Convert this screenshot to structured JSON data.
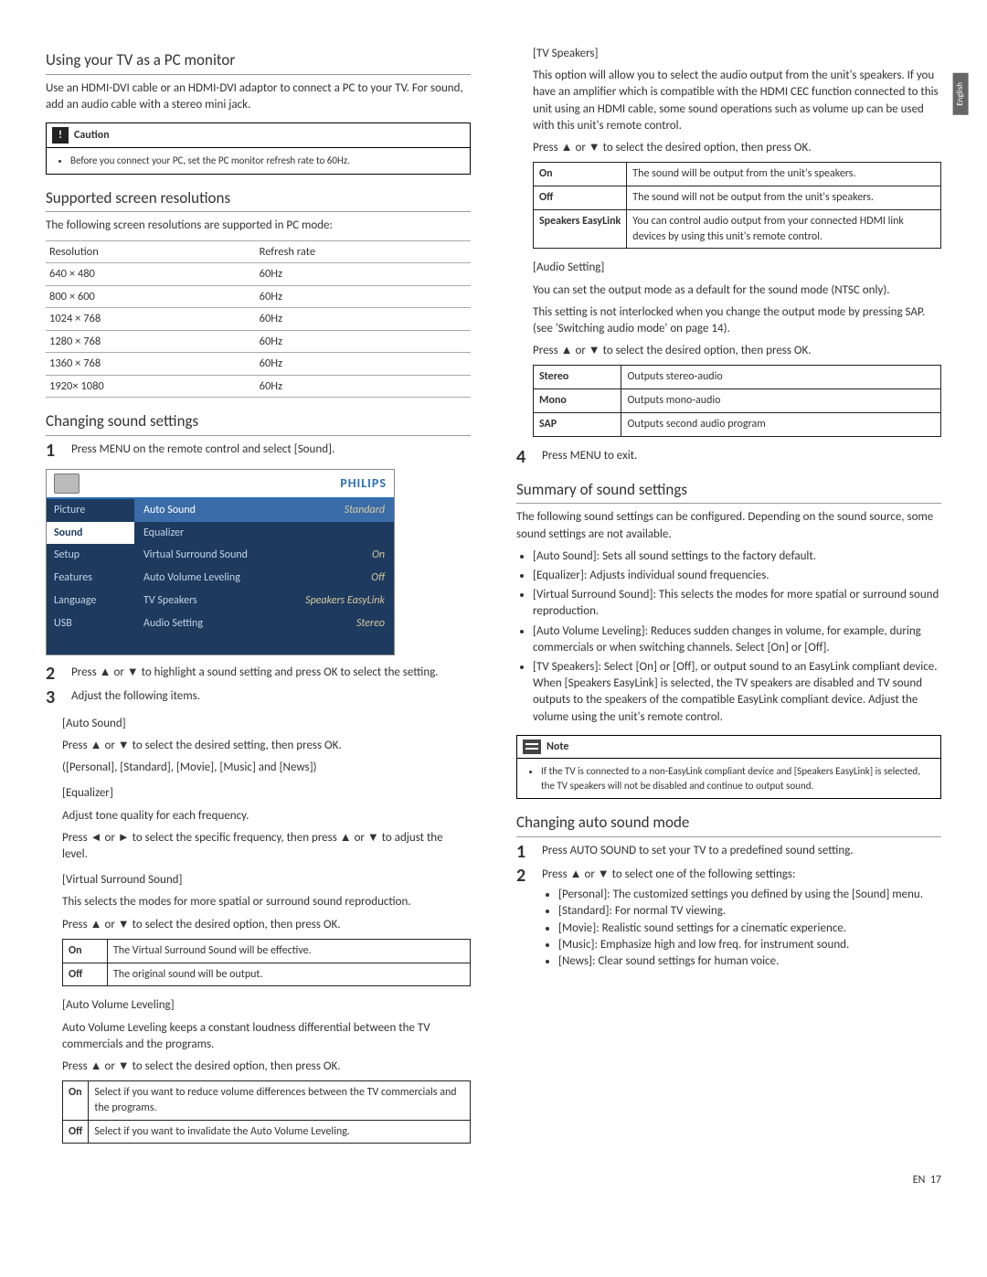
{
  "langTab": "English",
  "footer": {
    "lang": "EN",
    "page": "17"
  },
  "left": {
    "h_pc": "Using your TV as a PC monitor",
    "pc_intro": "Use an HDMI-DVI cable or an HDMI-DVI adaptor to connect a PC to your TV. For sound, add an audio cable with a stereo mini jack.",
    "caution_label": "Caution",
    "caution_item": "Before you connect your PC, set the PC monitor refresh rate to 60Hz.",
    "h_res": "Supported screen resolutions",
    "res_intro": "The following screen resolutions are supported in PC mode:",
    "res_h1": "Resolution",
    "res_h2": "Refresh rate",
    "res_rows": [
      [
        "640 × 480",
        "60Hz"
      ],
      [
        "800 × 600",
        "60Hz"
      ],
      [
        "1024 × 768",
        "60Hz"
      ],
      [
        "1280 × 768",
        "60Hz"
      ],
      [
        "1360 × 768",
        "60Hz"
      ],
      [
        "1920× 1080",
        "60Hz"
      ]
    ],
    "h_sound": "Changing sound settings",
    "step1": "Press MENU on the remote control and select [Sound].",
    "step2": "Press ▲ or ▼ to highlight a sound setting and press OK to select the setting.",
    "step3": "Adjust the following items.",
    "tv_logo": "PHILIPS",
    "tv_cats": [
      "Picture",
      "Sound",
      "Setup",
      "Features",
      "Language",
      "USB"
    ],
    "tv_rows": [
      [
        "Auto Sound",
        "Standard"
      ],
      [
        "Equalizer",
        ""
      ],
      [
        "Virtual Surround Sound",
        "On"
      ],
      [
        "Auto Volume Leveling",
        "Off"
      ],
      [
        "TV Speakers",
        "Speakers EasyLink"
      ],
      [
        "Audio Setting",
        "Stereo"
      ]
    ],
    "auto_sound_h": "[Auto Sound]",
    "auto_sound_p1": "Press ▲ or ▼ to select the desired setting, then press OK.",
    "auto_sound_p2": "([Personal], [Standard], [Movie], [Music] and [News])",
    "eq_h": "[Equalizer]",
    "eq_p1": "Adjust tone quality for each frequency.",
    "eq_p2": "Press ◄ or ► to select the specific frequency, then press ▲ or ▼ to adjust the level.",
    "vss_h": "[Virtual Surround Sound]",
    "vss_p1": "This selects the modes for more spatial or surround sound reproduction.",
    "vss_p2": "Press ▲ or ▼ to select the desired option, then press OK.",
    "vss_rows": [
      [
        "On",
        "The Virtual Surround Sound will be effective."
      ],
      [
        "Off",
        "The original sound will be output."
      ]
    ],
    "avl_h": "[Auto Volume Leveling]",
    "avl_p1": "Auto Volume Leveling keeps a constant loudness differential between the TV commercials and the programs.",
    "avl_p2": "Press ▲ or ▼ to select the desired option, then press OK.",
    "avl_rows": [
      [
        "On",
        "Select if you want to reduce volume differences between the TV commercials and the programs."
      ],
      [
        "Off",
        "Select if you want to invalidate the Auto Volume Leveling."
      ]
    ]
  },
  "right": {
    "tvs_h": "[TV Speakers]",
    "tvs_p1": "This option will allow you to select the audio output from the unit's speakers. If you have an amplifier which is compatible with the HDMI CEC function connected to this unit using an HDMI cable, some sound operations such as volume up can be used with this unit's remote control.",
    "tvs_p2": "Press ▲ or ▼ to select the desired option, then press OK.",
    "tvs_rows": [
      [
        "On",
        "The sound will be output from the unit's speakers."
      ],
      [
        "Off",
        "The sound will not be output from the unit's speakers."
      ],
      [
        "Speakers EasyLink",
        "You can control audio output from your connected HDMI link devices by using this unit's remote control."
      ]
    ],
    "aud_h": "[Audio Setting]",
    "aud_p1": "You can set the output mode as a default for the sound mode (NTSC only).",
    "aud_p2": "This setting is not interlocked when you change the output mode by pressing SAP. (see 'Switching audio mode' on page 14).",
    "aud_p3": "Press ▲ or ▼ to select the desired option, then press OK.",
    "aud_rows": [
      [
        "Stereo",
        "Outputs stereo-audio"
      ],
      [
        "Mono",
        "Outputs mono-audio"
      ],
      [
        "SAP",
        "Outputs second audio program"
      ]
    ],
    "step4": "Press MENU to exit.",
    "h_summary": "Summary of sound settings",
    "sum_intro": "The following sound settings can be configured. Depending on the sound source, some sound settings are not available.",
    "sum_items": [
      "[Auto Sound]: Sets all sound settings to the factory default.",
      "[Equalizer]: Adjusts individual sound frequencies.",
      "[Virtual Surround Sound]: This selects the modes for more spatial or surround sound reproduction.",
      "[Auto Volume Leveling]: Reduces sudden changes in volume, for example, during commercials or when switching channels. Select [On] or [Off].",
      "[TV Speakers]: Select [On] or [Off], or output sound to an EasyLink compliant device. When [Speakers EasyLink] is selected, the TV speakers are disabled and TV sound outputs to the speakers of the compatible EasyLink compliant device. Adjust the volume using the unit's remote control."
    ],
    "note_label": "Note",
    "note_item": "If the TV is connected to a non-EasyLink compliant device and [Speakers EasyLink] is selected, the TV speakers will not be disabled and continue to output sound.",
    "h_auto": "Changing auto sound mode",
    "auto_step1": "Press AUTO SOUND to set your TV to a predefined sound setting.",
    "auto_step2": "Press ▲ or ▼ to select one of the following settings:",
    "auto_items": [
      "[Personal]: The customized settings you defined by using the [Sound] menu.",
      "[Standard]: For normal TV viewing.",
      "[Movie]: Realistic sound settings for a cinematic experience.",
      "[Music]: Emphasize high and low freq. for instrument sound.",
      "[News]: Clear sound settings for human voice."
    ]
  }
}
